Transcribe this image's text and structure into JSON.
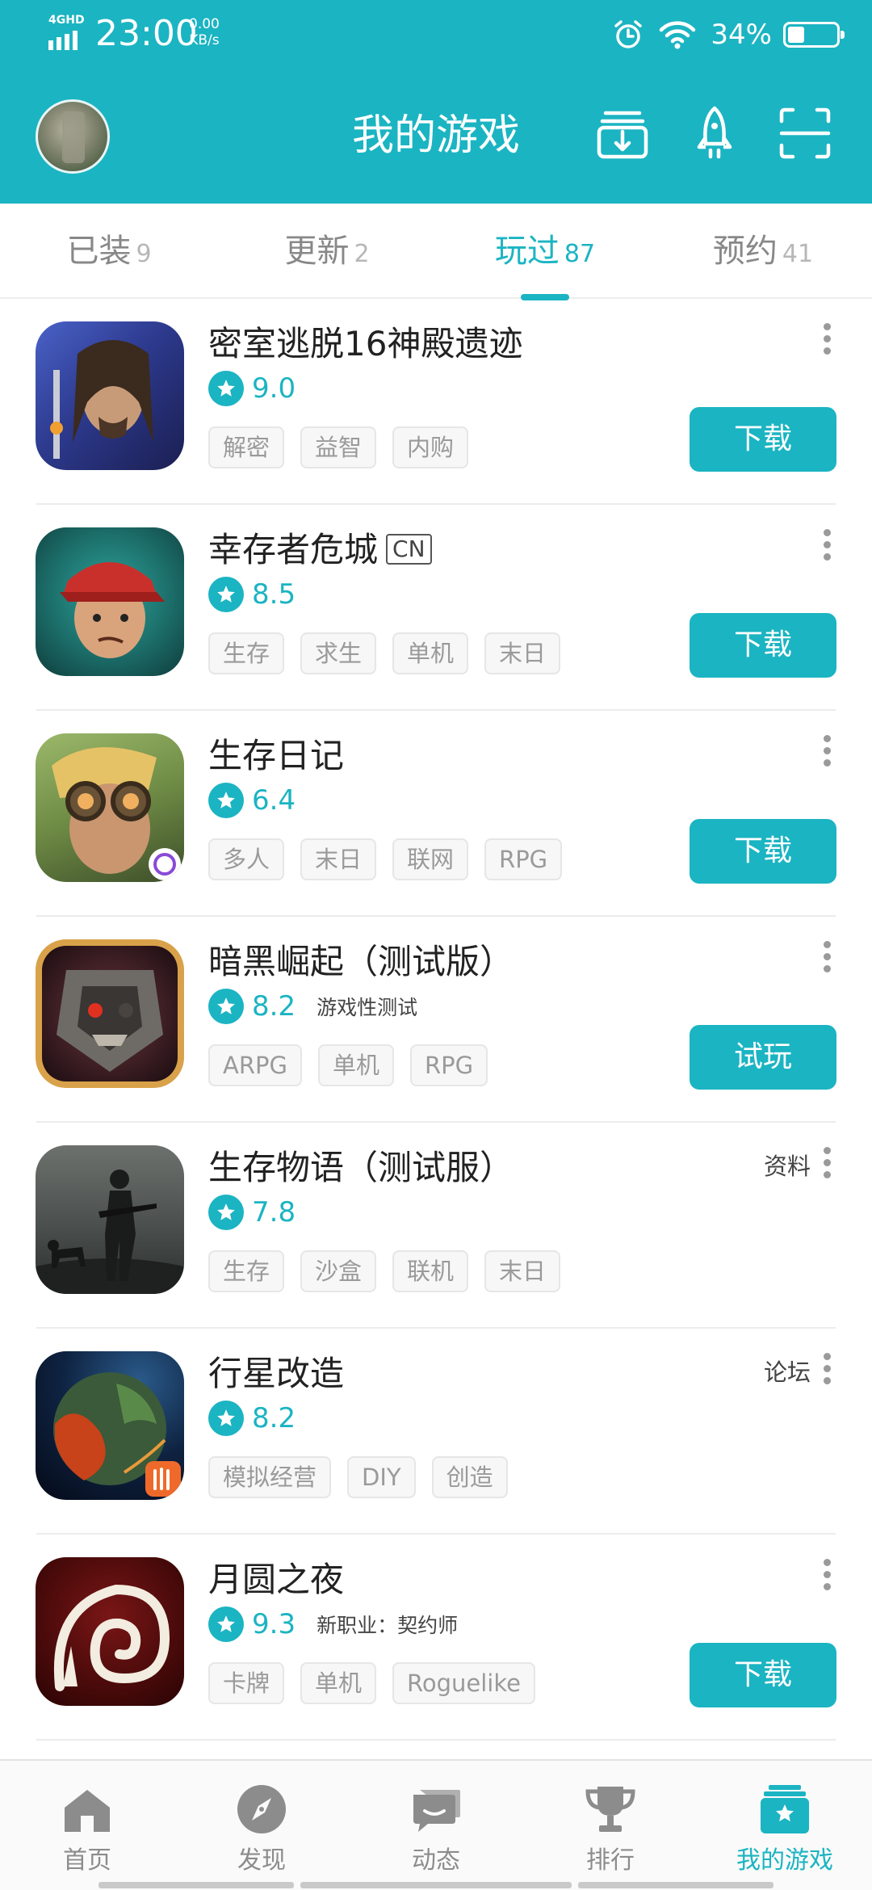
{
  "status_bar": {
    "network": "4GHD",
    "time": "23:00",
    "speed_value": "0.00",
    "speed_unit": "KB/s",
    "battery_percent": "34%",
    "battery_level": 0.34
  },
  "header": {
    "title": "我的游戏",
    "icons": [
      "download-manager-icon",
      "rocket-icon",
      "scan-icon"
    ]
  },
  "tabs": [
    {
      "label": "已装",
      "count": "9",
      "active": false
    },
    {
      "label": "更新",
      "count": "2",
      "active": false
    },
    {
      "label": "玩过",
      "count": "87",
      "active": true
    },
    {
      "label": "预约",
      "count": "41",
      "active": false
    }
  ],
  "games": [
    {
      "name": "密室逃脱16神殿遗迹",
      "badge": "",
      "score": "9.0",
      "note": "",
      "tags": [
        "解密",
        "益智",
        "内购"
      ],
      "link": "",
      "button": "下载"
    },
    {
      "name": "幸存者危城",
      "badge": "CN",
      "score": "8.5",
      "note": "",
      "tags": [
        "生存",
        "求生",
        "单机",
        "末日"
      ],
      "link": "",
      "button": "下载"
    },
    {
      "name": "生存日记",
      "badge": "",
      "score": "6.4",
      "note": "",
      "tags": [
        "多人",
        "末日",
        "联网",
        "RPG"
      ],
      "link": "",
      "button": "下载"
    },
    {
      "name": "暗黑崛起（测试版）",
      "badge": "",
      "score": "8.2",
      "note": "游戏性测试",
      "tags": [
        "ARPG",
        "单机",
        "RPG"
      ],
      "link": "",
      "button": "试玩"
    },
    {
      "name": "生存物语（测试服）",
      "badge": "",
      "score": "7.8",
      "note": "",
      "tags": [
        "生存",
        "沙盒",
        "联机",
        "末日"
      ],
      "link": "资料",
      "button": ""
    },
    {
      "name": "行星改造",
      "badge": "",
      "score": "8.2",
      "note": "",
      "tags": [
        "模拟经营",
        "DIY",
        "创造"
      ],
      "link": "论坛",
      "button": ""
    },
    {
      "name": "月圆之夜",
      "badge": "",
      "score": "9.3",
      "note": "新职业：契约师",
      "tags": [
        "卡牌",
        "单机",
        "Roguelike"
      ],
      "link": "",
      "button": "下载"
    }
  ],
  "bottom_nav": [
    {
      "label": "首页",
      "icon": "home-icon",
      "active": false
    },
    {
      "label": "发现",
      "icon": "compass-icon",
      "active": false
    },
    {
      "label": "动态",
      "icon": "chat-icon",
      "active": false
    },
    {
      "label": "排行",
      "icon": "trophy-icon",
      "active": false
    },
    {
      "label": "我的游戏",
      "icon": "my-games-icon",
      "active": true
    }
  ],
  "colors": {
    "accent": "#1bb4c2",
    "tag_text": "#9a9a9a",
    "nav_inactive": "#8c8c8c"
  }
}
